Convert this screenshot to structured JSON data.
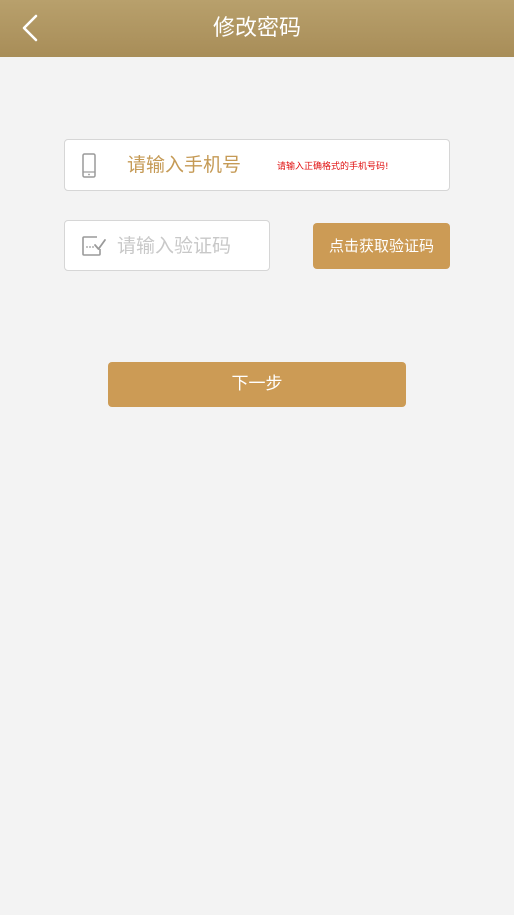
{
  "header": {
    "title": "修改密码",
    "back_icon": "chevron-left-icon"
  },
  "phone_field": {
    "icon": "mobile-phone-icon",
    "placeholder": "请输入手机号",
    "error_text": "请输入正确格式的手机号码!"
  },
  "code_field": {
    "icon": "verify-code-icon",
    "placeholder": "请输入验证码"
  },
  "get_code_button": {
    "label": "点击获取验证码"
  },
  "next_button": {
    "label": "下一步"
  },
  "colors": {
    "header_bg": "#a88d58",
    "accent": "#cc9b55",
    "error": "#e01010",
    "background": "#f3f3f3"
  }
}
